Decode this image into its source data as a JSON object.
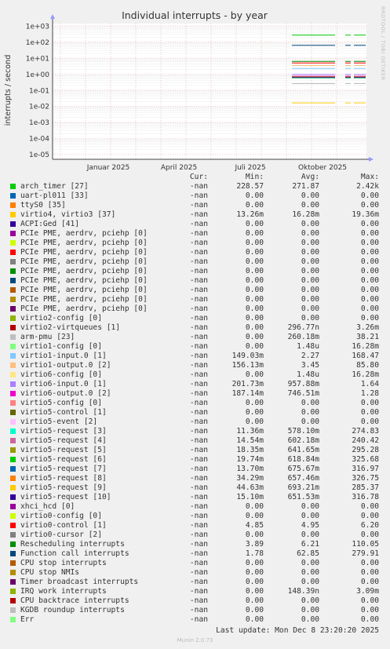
{
  "chart_data": {
    "type": "line",
    "title": "Individual interrupts - by year",
    "ylabel": "interrupts / second",
    "yscale": "log",
    "ylim": [
      5e-06,
      1000
    ],
    "y_tick_labels": [
      "1e+03",
      "1e+02",
      "1e+01",
      "1e+00",
      "1e-01",
      "1e-02",
      "1e-03",
      "1e-04",
      "1e-05"
    ],
    "x_tick_labels": [
      "Januar 2025",
      "April 2025",
      "Juli 2025",
      "Oktober 2025"
    ],
    "watermark": "RRDTOOL / TOBI OETIKER",
    "columns": [
      "Cur:",
      "Min:",
      "Avg:",
      "Max:"
    ],
    "series": [
      {
        "name": "arch_timer [27]",
        "color": "#00cc00",
        "cur": "-nan",
        "min": "228.57",
        "avg": "271.87",
        "max": "2.42k"
      },
      {
        "name": "uart-pl011 [33]",
        "color": "#0066b3",
        "cur": "-nan",
        "min": "0.00",
        "avg": "0.00",
        "max": "0.00"
      },
      {
        "name": "ttyS0 [35]",
        "color": "#ff8000",
        "cur": "-nan",
        "min": "0.00",
        "avg": "0.00",
        "max": "0.00"
      },
      {
        "name": "virtio4, virtio3 [37]",
        "color": "#ffcc00",
        "cur": "-nan",
        "min": "13.26m",
        "avg": "16.28m",
        "max": "19.36m"
      },
      {
        "name": "ACPI:Ged [41]",
        "color": "#330099",
        "cur": "-nan",
        "min": "0.00",
        "avg": "0.00",
        "max": "0.00"
      },
      {
        "name": "PCIe PME, aerdrv, pciehp [0]",
        "color": "#990099",
        "cur": "-nan",
        "min": "0.00",
        "avg": "0.00",
        "max": "0.00"
      },
      {
        "name": "PCIe PME, aerdrv, pciehp [0]",
        "color": "#ccff00",
        "cur": "-nan",
        "min": "0.00",
        "avg": "0.00",
        "max": "0.00"
      },
      {
        "name": "PCIe PME, aerdrv, pciehp [0]",
        "color": "#ff0000",
        "cur": "-nan",
        "min": "0.00",
        "avg": "0.00",
        "max": "0.00"
      },
      {
        "name": "PCIe PME, aerdrv, pciehp [0]",
        "color": "#808080",
        "cur": "-nan",
        "min": "0.00",
        "avg": "0.00",
        "max": "0.00"
      },
      {
        "name": "PCIe PME, aerdrv, pciehp [0]",
        "color": "#008f00",
        "cur": "-nan",
        "min": "0.00",
        "avg": "0.00",
        "max": "0.00"
      },
      {
        "name": "PCIe PME, aerdrv, pciehp [0]",
        "color": "#00487d",
        "cur": "-nan",
        "min": "0.00",
        "avg": "0.00",
        "max": "0.00"
      },
      {
        "name": "PCIe PME, aerdrv, pciehp [0]",
        "color": "#b35a00",
        "cur": "-nan",
        "min": "0.00",
        "avg": "0.00",
        "max": "0.00"
      },
      {
        "name": "PCIe PME, aerdrv, pciehp [0]",
        "color": "#b38f00",
        "cur": "-nan",
        "min": "0.00",
        "avg": "0.00",
        "max": "0.00"
      },
      {
        "name": "PCIe PME, aerdrv, pciehp [0]",
        "color": "#6b006b",
        "cur": "-nan",
        "min": "0.00",
        "avg": "0.00",
        "max": "0.00"
      },
      {
        "name": "virtio2-config [0]",
        "color": "#8fb300",
        "cur": "-nan",
        "min": "0.00",
        "avg": "0.00",
        "max": "0.00"
      },
      {
        "name": "virtio2-virtqueues [1]",
        "color": "#b30000",
        "cur": "-nan",
        "min": "0.00",
        "avg": "296.77n",
        "max": "3.26m"
      },
      {
        "name": "arm-pmu [23]",
        "color": "#bebebe",
        "cur": "-nan",
        "min": "0.00",
        "avg": "260.18m",
        "max": "38.21"
      },
      {
        "name": "virtio1-config [0]",
        "color": "#80ff80",
        "cur": "-nan",
        "min": "0.00",
        "avg": "1.48u",
        "max": "16.28m"
      },
      {
        "name": "virtio1-input.0 [1]",
        "color": "#80c9ff",
        "cur": "-nan",
        "min": "149.03m",
        "avg": "2.27",
        "max": "168.47"
      },
      {
        "name": "virtio1-output.0 [2]",
        "color": "#ffc080",
        "cur": "-nan",
        "min": "156.13m",
        "avg": "3.45",
        "max": "85.80"
      },
      {
        "name": "virtio6-config [0]",
        "color": "#ffe680",
        "cur": "-nan",
        "min": "0.00",
        "avg": "1.48u",
        "max": "16.28m"
      },
      {
        "name": "virtio6-input.0 [1]",
        "color": "#aa80ff",
        "cur": "-nan",
        "min": "201.73m",
        "avg": "957.88m",
        "max": "1.64"
      },
      {
        "name": "virtio6-output.0 [2]",
        "color": "#ee00cc",
        "cur": "-nan",
        "min": "187.14m",
        "avg": "746.51m",
        "max": "1.28"
      },
      {
        "name": "virtio5-config [0]",
        "color": "#ff8080",
        "cur": "-nan",
        "min": "0.00",
        "avg": "0.00",
        "max": "0.00"
      },
      {
        "name": "virtio5-control [1]",
        "color": "#666600",
        "cur": "-nan",
        "min": "0.00",
        "avg": "0.00",
        "max": "0.00"
      },
      {
        "name": "virtio5-event [2]",
        "color": "#ffbfff",
        "cur": "-nan",
        "min": "0.00",
        "avg": "0.00",
        "max": "0.00"
      },
      {
        "name": "virtio5-request [3]",
        "color": "#00ffcc",
        "cur": "-nan",
        "min": "11.36m",
        "avg": "578.10m",
        "max": "274.83"
      },
      {
        "name": "virtio5-request [4]",
        "color": "#cc6699",
        "cur": "-nan",
        "min": "14.54m",
        "avg": "602.18m",
        "max": "240.42"
      },
      {
        "name": "virtio5-request [5]",
        "color": "#999900",
        "cur": "-nan",
        "min": "18.35m",
        "avg": "641.65m",
        "max": "295.28"
      },
      {
        "name": "virtio5-request [6]",
        "color": "#00cc00",
        "cur": "-nan",
        "min": "19.74m",
        "avg": "618.84m",
        "max": "325.68"
      },
      {
        "name": "virtio5-request [7]",
        "color": "#0066b3",
        "cur": "-nan",
        "min": "13.70m",
        "avg": "675.67m",
        "max": "316.97"
      },
      {
        "name": "virtio5-request [8]",
        "color": "#ff8000",
        "cur": "-nan",
        "min": "34.29m",
        "avg": "657.46m",
        "max": "326.75"
      },
      {
        "name": "virtio5-request [9]",
        "color": "#ffcc00",
        "cur": "-nan",
        "min": "44.63m",
        "avg": "693.21m",
        "max": "285.37"
      },
      {
        "name": "virtio5-request [10]",
        "color": "#330099",
        "cur": "-nan",
        "min": "15.10m",
        "avg": "651.53m",
        "max": "316.78"
      },
      {
        "name": "xhci_hcd [0]",
        "color": "#990099",
        "cur": "-nan",
        "min": "0.00",
        "avg": "0.00",
        "max": "0.00"
      },
      {
        "name": "virtio0-config [0]",
        "color": "#ccff00",
        "cur": "-nan",
        "min": "0.00",
        "avg": "0.00",
        "max": "0.00"
      },
      {
        "name": "virtio0-control [1]",
        "color": "#ff0000",
        "cur": "-nan",
        "min": "4.85",
        "avg": "4.95",
        "max": "6.20"
      },
      {
        "name": "virtio0-cursor [2]",
        "color": "#808080",
        "cur": "-nan",
        "min": "0.00",
        "avg": "0.00",
        "max": "0.00"
      },
      {
        "name": "Rescheduling interrupts",
        "color": "#008f00",
        "cur": "-nan",
        "min": "3.89",
        "avg": "6.21",
        "max": "110.05"
      },
      {
        "name": "Function call interrupts",
        "color": "#00487d",
        "cur": "-nan",
        "min": "1.78",
        "avg": "62.85",
        "max": "279.91"
      },
      {
        "name": "CPU stop interrupts",
        "color": "#b35a00",
        "cur": "-nan",
        "min": "0.00",
        "avg": "0.00",
        "max": "0.00"
      },
      {
        "name": "CPU stop NMIs",
        "color": "#b38f00",
        "cur": "-nan",
        "min": "0.00",
        "avg": "0.00",
        "max": "0.00"
      },
      {
        "name": "Timer broadcast interrupts",
        "color": "#6b006b",
        "cur": "-nan",
        "min": "0.00",
        "avg": "0.00",
        "max": "0.00"
      },
      {
        "name": "IRQ work interrupts",
        "color": "#8fb300",
        "cur": "-nan",
        "min": "0.00",
        "avg": "148.39n",
        "max": "3.09m"
      },
      {
        "name": "CPU backtrace interrupts",
        "color": "#b30000",
        "cur": "-nan",
        "min": "0.00",
        "avg": "0.00",
        "max": "0.00"
      },
      {
        "name": "KGDB roundup interrupts",
        "color": "#bebebe",
        "cur": "-nan",
        "min": "0.00",
        "avg": "0.00",
        "max": "0.00"
      },
      {
        "name": "Err",
        "color": "#80ff80",
        "cur": "-nan",
        "min": "0.00",
        "avg": "0.00",
        "max": "0.00"
      }
    ],
    "grid": true,
    "legend_placement": "bottom"
  },
  "footer": {
    "last_update": "Last update: Mon Dec  8 23:20:20 2025",
    "version": "Munin 2.0.73"
  }
}
